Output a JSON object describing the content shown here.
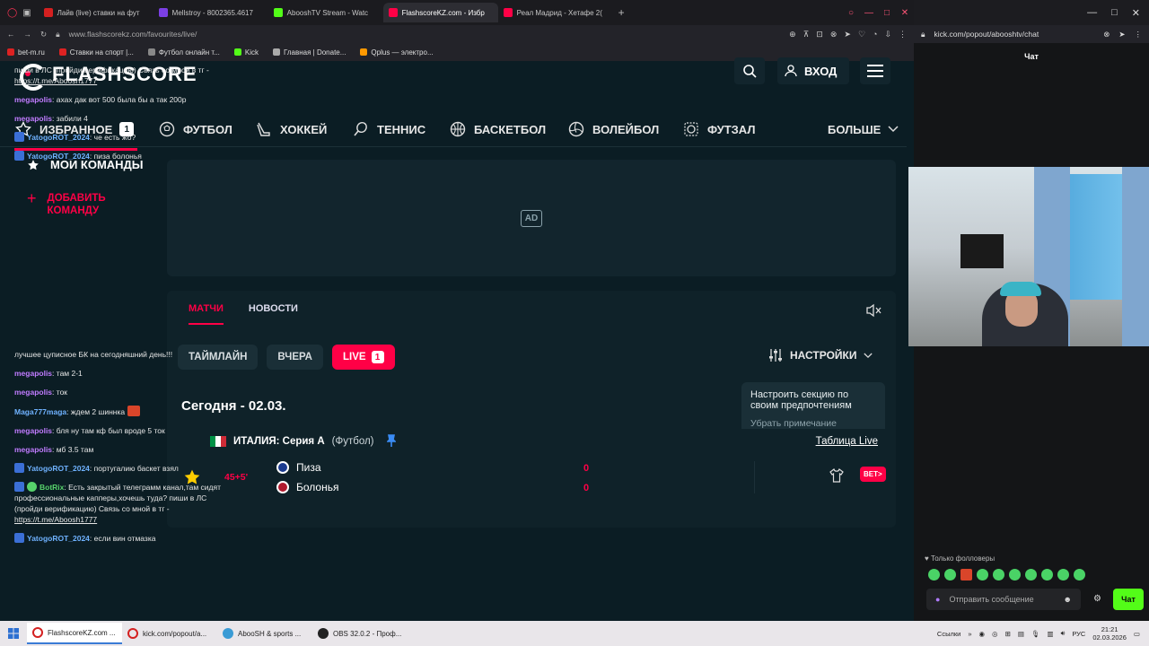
{
  "browser_left": {
    "tabs": [
      {
        "label": "Лайв (live) ставки на фут",
        "color": "#d42020"
      },
      {
        "label": "Mellstroy - 8002365.4617",
        "color": "#7b3fe4"
      },
      {
        "label": "AbooshTV Stream - Watc",
        "color": "#53fc18"
      },
      {
        "label": "FlashscoreKZ.com - Избр",
        "color": "#ff0046",
        "active": true
      },
      {
        "label": "Реал Мадрид - Хетафе 2(",
        "color": "#ff0046"
      }
    ],
    "url": "www.flashscorekz.com/favourites/live/",
    "bookmarks": [
      "bet-m.ru",
      "Ставки на спорт |...",
      "Футбол онлайн т...",
      "Kick",
      "Главная | Donate...",
      "Qplus — электро..."
    ]
  },
  "flashscore": {
    "logo": "FLASHSCORE",
    "login_label": "ВХОД",
    "nav": [
      {
        "label": "ИЗБРАННОЕ",
        "badge": "1",
        "icon": "star-icon"
      },
      {
        "label": "ФУТБОЛ",
        "icon": "football-icon"
      },
      {
        "label": "ХОККЕЙ",
        "icon": "hockey-icon"
      },
      {
        "label": "ТЕННИС",
        "icon": "tennis-icon"
      },
      {
        "label": "БАСКЕТБОЛ",
        "icon": "basketball-icon"
      },
      {
        "label": "ВОЛЕЙБОЛ",
        "icon": "volleyball-icon"
      },
      {
        "label": "ФУТЗАЛ",
        "icon": "futsal-icon"
      }
    ],
    "more_label": "БОЛЬШЕ",
    "sidebar": {
      "title": "МОИ КОМАНДЫ",
      "add_label": "ДОБАВИТЬ КОМАНДУ"
    },
    "ad_label": "AD",
    "panel": {
      "tabs": [
        "МАТЧИ",
        "НОВОСТИ"
      ],
      "filters": {
        "timeline": "ТАЙМЛАЙН",
        "yesterday": "ВЧЕРА",
        "live": "LIVE",
        "live_count": "1"
      },
      "settings_label": "НАСТРОЙКИ",
      "tooltip_text": "Настроить секцию по своим предпочтениям",
      "tooltip_dismiss": "Убрать примечание",
      "today": "Сегодня - 02.03.",
      "league": {
        "country": "ИТАЛИЯ: Серия А",
        "sport": "(Футбол)",
        "table_link": "Таблица Live"
      },
      "match": {
        "time": "45+5'",
        "home": "Пиза",
        "away": "Болонья",
        "home_score": "0",
        "away_score": "0",
        "bet_label": "BET>"
      }
    }
  },
  "chat": {
    "url": "kick.com/popout/abooshtv/chat",
    "title": "Чат",
    "top_messages": [
      {
        "text": "пиши в ЛС (пройди верификацию) Связь со мной в тг - ",
        "link": "https://t.me/Aboosh1777"
      },
      {
        "user": "megapolis",
        "text": ": ахах дак вот 500 была бы а так 200р"
      },
      {
        "user": "megapolis",
        "text": ": забили 4"
      },
      {
        "user": "YatogoROT_2024",
        "text": ": че есть жб?"
      },
      {
        "user": "YatogoROT_2024",
        "text": ": пиза болонья"
      }
    ],
    "bottom_messages": [
      {
        "text": "лучшее цуписное БК на сегодняшний день!!!"
      },
      {
        "user": "megapolis",
        "text": ": там 2-1"
      },
      {
        "user": "megapolis",
        "text": ": ток"
      },
      {
        "user": "Maga777maga",
        "text": ": ждем 2 шиннка"
      },
      {
        "user": "megapolis",
        "text": ": бля ну там кф был вроде 5 ток"
      },
      {
        "user": "megapolis",
        "text": ": мб 3.5 там"
      },
      {
        "user": "YatogoROT_2024",
        "text": ": португалию баскет взял"
      },
      {
        "user": "BotRix",
        "text": ": Есть закрытый телеграмм канал,там сидят профессиональные капперы,хочешь туда? пиши в ЛС (пройди верификацию) Связь со мной в тг - ",
        "link": "https://t.me/Aboosh1777"
      },
      {
        "user": "YatogoROT_2024",
        "text": ": если вин отмазка"
      }
    ],
    "followers_only": "Только фолловеры",
    "input_placeholder": "Отправить сообщение",
    "send_label": "Чат"
  },
  "taskbar": {
    "items": [
      {
        "label": "FlashscoreKZ.com ...",
        "color": "#d42020",
        "active": true
      },
      {
        "label": "kick.com/popout/a...",
        "color": "#d42020"
      },
      {
        "label": "AbooSH & sports ...",
        "color": "#3a9bd5"
      },
      {
        "label": "OBS 32.0.2 - Проф...",
        "color": "#222222"
      }
    ],
    "links_label": "Ссылки",
    "lang": "РУС",
    "time": "21:21",
    "date": "02.03.2026"
  },
  "colors": {
    "accent": "#ff0046",
    "page_bg": "#0b1d24",
    "kick_green": "#53fc18"
  }
}
